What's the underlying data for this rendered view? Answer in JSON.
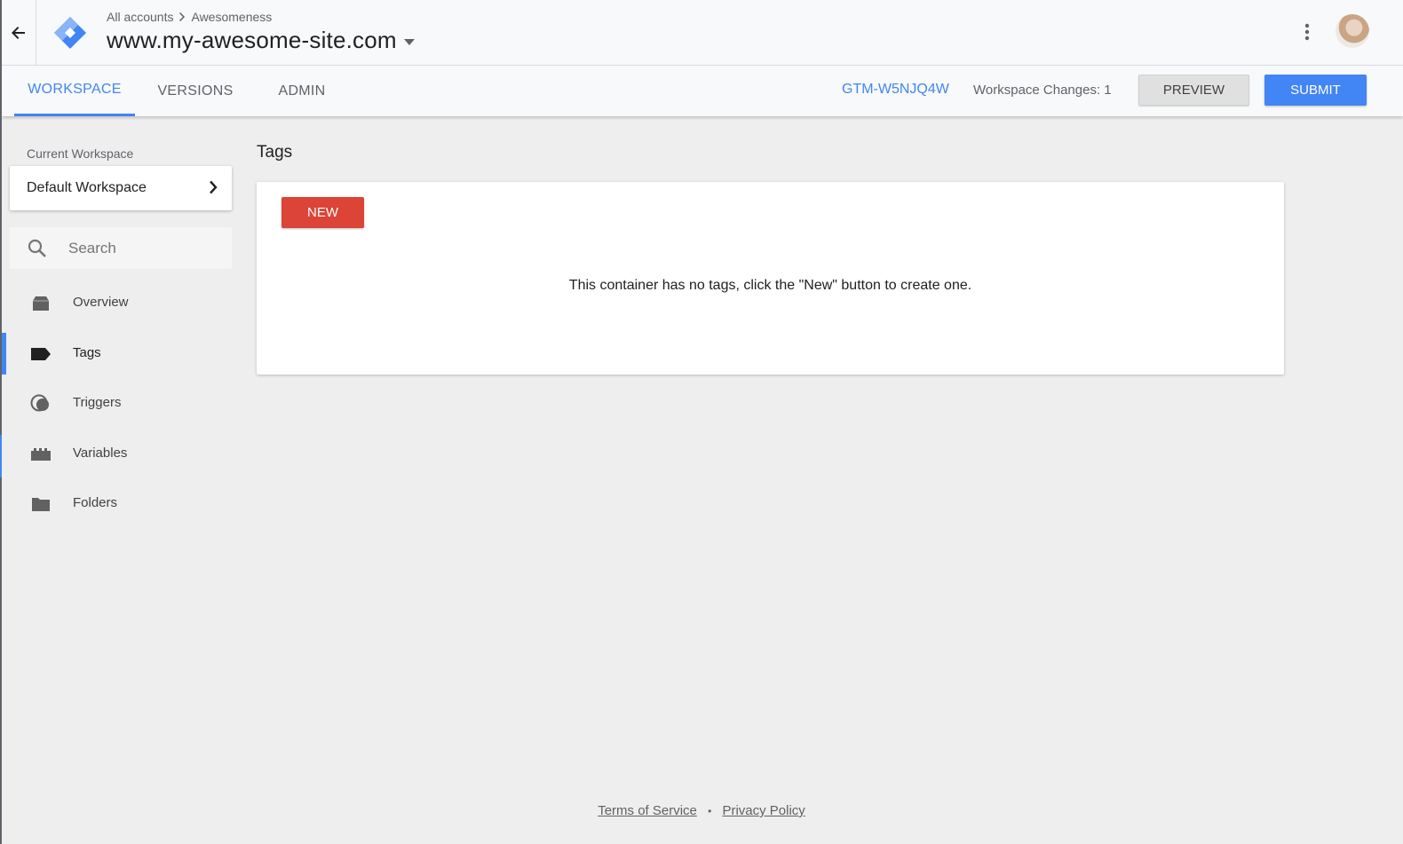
{
  "header": {
    "breadcrumb": {
      "root": "All accounts",
      "account": "Awesomeness"
    },
    "container_name": "www.my-awesome-site.com",
    "icons": {
      "back": "arrow-left-icon",
      "logo": "gtm-diamond-logo",
      "menu": "more-vert-icon",
      "caret": "dropdown-caret-icon"
    }
  },
  "tabs": [
    {
      "label": "WORKSPACE",
      "active": true
    },
    {
      "label": "VERSIONS",
      "active": false
    },
    {
      "label": "ADMIN",
      "active": false
    }
  ],
  "toolbar": {
    "container_id": "GTM-W5NJQ4W",
    "workspace_changes": "Workspace Changes: 1",
    "preview_label": "PREVIEW",
    "submit_label": "SUBMIT"
  },
  "sidebar": {
    "current_workspace_label": "Current Workspace",
    "workspace_name": "Default Workspace",
    "search_placeholder": "Search",
    "items": [
      {
        "label": "Overview",
        "icon": "overview-tray-icon",
        "active": false
      },
      {
        "label": "Tags",
        "icon": "tag-icon",
        "active": true
      },
      {
        "label": "Triggers",
        "icon": "trigger-circles-icon",
        "active": false
      },
      {
        "label": "Variables",
        "icon": "variables-brick-icon",
        "active": false
      },
      {
        "label": "Folders",
        "icon": "folder-icon",
        "active": false
      }
    ]
  },
  "main": {
    "title": "Tags",
    "new_button": "NEW",
    "empty_message": "This container has no tags, click the \"New\" button to create one."
  },
  "footer": {
    "terms": "Terms of Service",
    "separator": "•",
    "privacy": "Privacy Policy"
  },
  "colors": {
    "accent": "#4285f4",
    "danger": "#db4437",
    "background": "#eeeeee"
  }
}
